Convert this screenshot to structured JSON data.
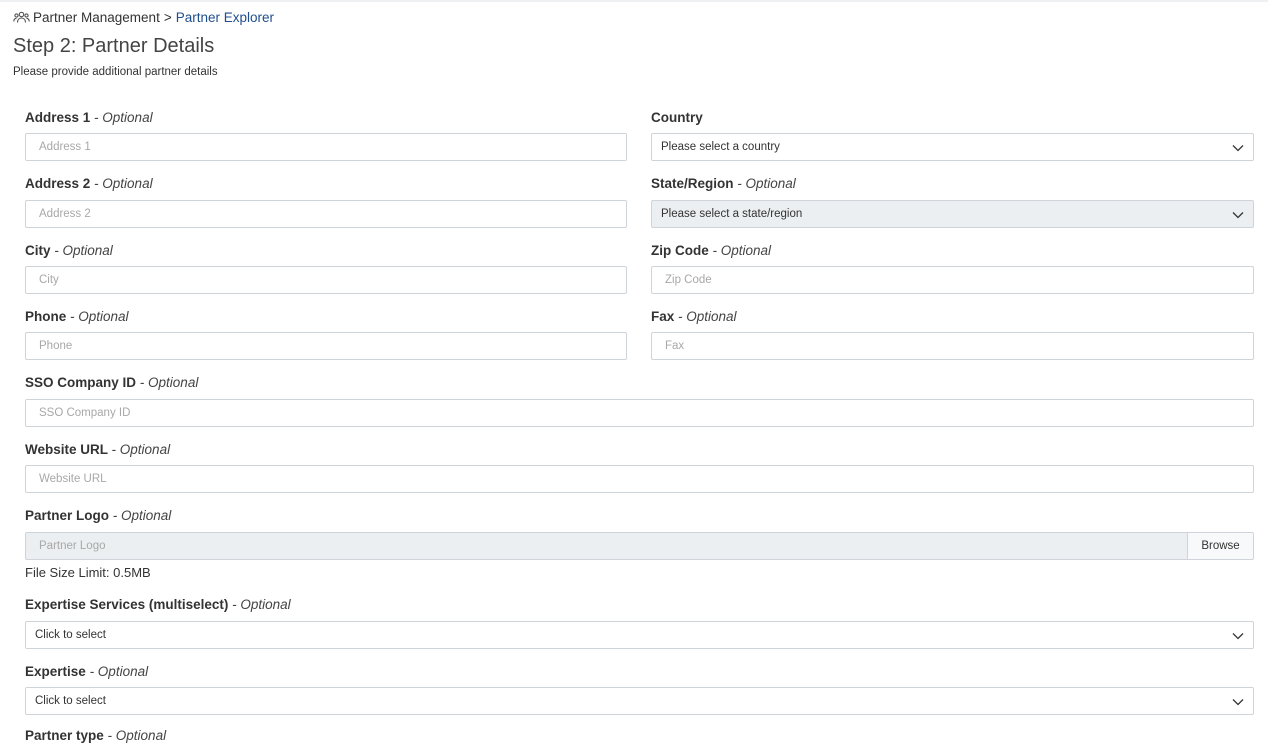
{
  "breadcrumb": {
    "parent": "Partner Management",
    "separator": ">",
    "current": "Partner Explorer",
    "icon": "users-icon"
  },
  "page": {
    "title": "Step 2: Partner Details",
    "subtitle": "Please provide additional partner details"
  },
  "optional_suffix": "- Optional",
  "fields": {
    "address1": {
      "label": "Address 1",
      "placeholder": "Address 1"
    },
    "address2": {
      "label": "Address 2",
      "placeholder": "Address 2"
    },
    "city": {
      "label": "City",
      "placeholder": "City"
    },
    "phone": {
      "label": "Phone",
      "placeholder": "Phone"
    },
    "country": {
      "label": "Country",
      "value": "Please select a country"
    },
    "state": {
      "label": "State/Region",
      "value": "Please select a state/region"
    },
    "zip": {
      "label": "Zip Code",
      "placeholder": "Zip Code"
    },
    "fax": {
      "label": "Fax",
      "placeholder": "Fax"
    },
    "sso": {
      "label": "SSO Company ID",
      "placeholder": "SSO Company ID"
    },
    "website": {
      "label": "Website URL",
      "placeholder": "Website URL"
    },
    "logo": {
      "label": "Partner Logo",
      "placeholder": "Partner Logo",
      "browse_label": "Browse",
      "help": "File Size Limit: 0.5MB"
    },
    "expertise_services": {
      "label": "Expertise Services (multiselect)",
      "value": "Click to select"
    },
    "expertise": {
      "label": "Expertise",
      "value": "Click to select"
    },
    "partner_type": {
      "label": "Partner type"
    }
  },
  "colors": {
    "link": "#1f4e8c",
    "border": "#ced4da",
    "disabled_bg": "#eceff1"
  }
}
